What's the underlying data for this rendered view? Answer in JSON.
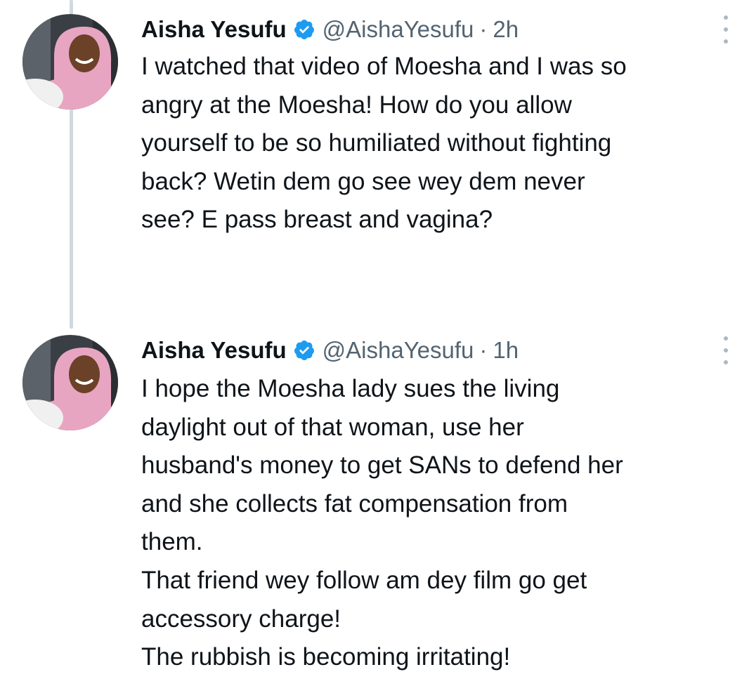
{
  "colors": {
    "text": "#0f1419",
    "secondary": "#536471",
    "verified": "#1d9bf0",
    "thread_line": "#cfd9de",
    "avatar_garment": "#e8a5c1"
  },
  "tweets": [
    {
      "name": "Aisha Yesufu",
      "verified_icon": "verified-badge-icon",
      "handle": "@AishaYesufu",
      "separator": "·",
      "time": "2h",
      "text_lines": [
        "I watched that video of Moesha and I was so",
        "angry at the Moesha! How do you allow",
        "yourself to be so humiliated without fighting",
        "back? Wetin dem go see wey dem never",
        "see? E pass breast and vagina?"
      ]
    },
    {
      "name": "Aisha Yesufu",
      "verified_icon": "verified-badge-icon",
      "handle": "@AishaYesufu",
      "separator": "·",
      "time": "1h",
      "text_lines": [
        "I hope the Moesha lady sues the living",
        "daylight out of that woman, use her",
        "husband's money to get SANs to defend her",
        "and she collects fat compensation from",
        "them.",
        "That friend wey follow am dey film go get",
        "accessory charge!",
        "The rubbish is becoming irritating!"
      ]
    }
  ]
}
